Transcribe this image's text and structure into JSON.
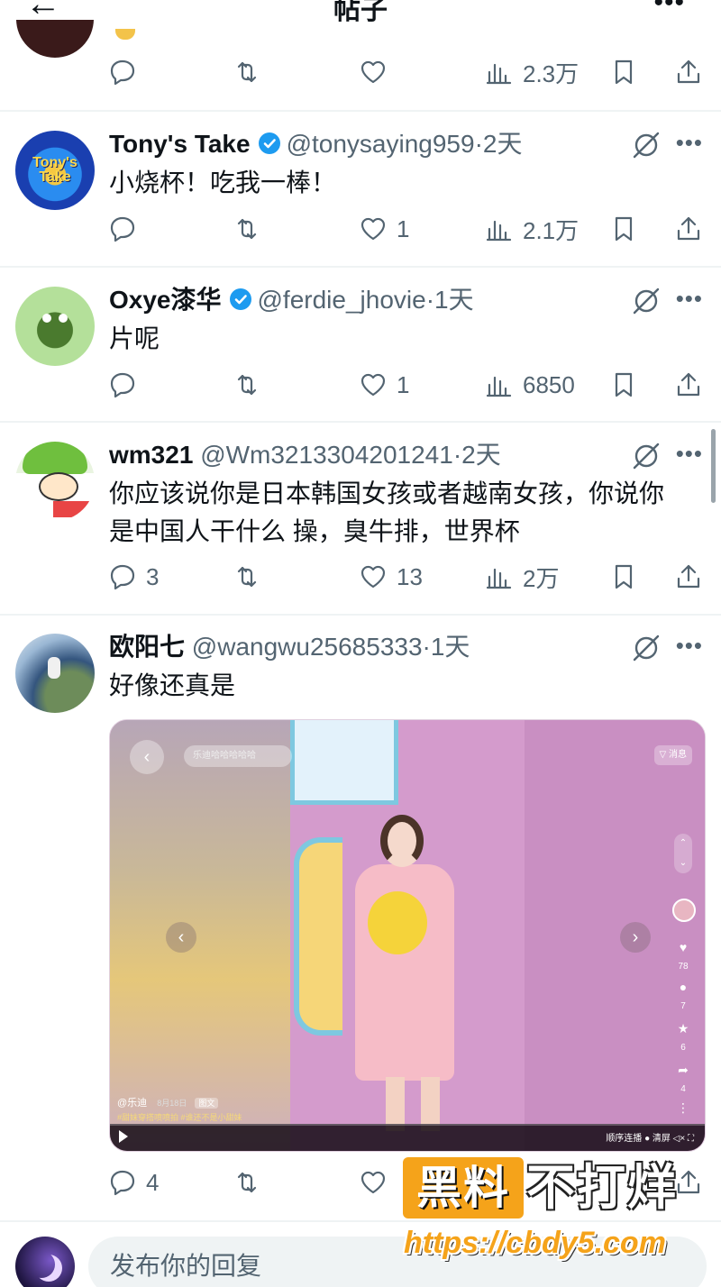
{
  "header": {
    "title": "帖子",
    "back_icon": "arrow-left-icon",
    "more_icon": "more-icon"
  },
  "previous_post": {
    "stats": {
      "reply": "",
      "retweet": "",
      "like": "",
      "views": "2.3万"
    }
  },
  "tweets": [
    {
      "name": "Tony's Take",
      "verified": true,
      "handle": "@tonysaying959",
      "time": "·2天",
      "text": "小烧杯！吃我一棒！",
      "stats": {
        "reply": "",
        "retweet": "",
        "like": "1",
        "views": "2.1万"
      },
      "avatar_colors": [
        "#1a55c8",
        "#f5c842"
      ],
      "avatar_text": "Tony's Take"
    },
    {
      "name": "Oxye漆华",
      "verified": true,
      "handle": "@ferdie_jhovie",
      "time": "·1天",
      "text": "片呢",
      "stats": {
        "reply": "",
        "retweet": "",
        "like": "1",
        "views": "6850"
      },
      "avatar_colors": [
        "#a8d88a",
        "#3d6b2a"
      ]
    },
    {
      "name": "wm321",
      "verified": false,
      "handle": "@Wm3213304201241",
      "time": "·2天",
      "text_lines": [
        "你应该说你是日本韩国女孩或者越南女孩，你说你",
        "是中国人干什么 操，臭牛排，世界杯"
      ],
      "stats": {
        "reply": "3",
        "retweet": "",
        "like": "13",
        "views": "2万"
      },
      "avatar_colors": [
        "#eaf3e2",
        "#7cc24a"
      ]
    },
    {
      "name": "欧阳七",
      "verified": false,
      "handle": "@wangwu25685333",
      "time": "·1天",
      "text": "好像还真是",
      "stats": {
        "reply": "4",
        "retweet": "",
        "like": "",
        "views": ""
      },
      "avatar_colors": [
        "#2a3f5c",
        "#9cb7cf"
      ]
    }
  ],
  "media": {
    "search_placeholder": "乐迪哈哈哈哈哈",
    "message_label": "▽ 消息",
    "author": "@乐迪",
    "date": "8月18日",
    "badge": "图文",
    "tags": "#甜妹穿搭喷喷拍  #谁还不是小甜妹",
    "side_counts": [
      "78",
      "7",
      "6",
      "4"
    ],
    "controls": "顺序连播   ● 清屏   ◁×  ⛶"
  },
  "reply_bar": {
    "placeholder": "发布你的回复"
  },
  "watermark": {
    "box_text": "黑料",
    "tail_text": "不打烊",
    "url": "https://cbdy5.com"
  },
  "colors": {
    "verified": "#1d9bf0",
    "muted": "#536471",
    "watermark": "#f5a31a"
  }
}
